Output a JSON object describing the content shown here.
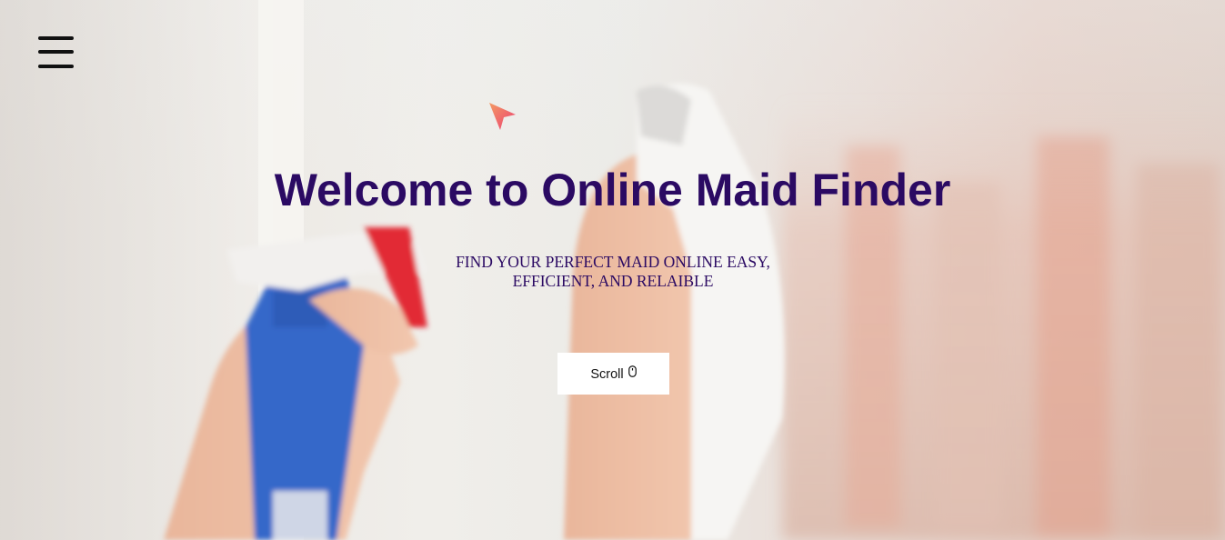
{
  "hero": {
    "title": "Welcome to Online Maid Finder",
    "subtitle_line1": "FIND YOUR PERFECT MAID ONLINE EASY,",
    "subtitle_line2": "EFFICIENT, AND RELAIBLE",
    "background_image": "hand-cleaning-window-with-spray-bottle-and-cloth"
  },
  "nav": {
    "menu_icon": "hamburger-menu-icon"
  },
  "cursor": {
    "icon": "arrow-pointer-icon",
    "color": "#f05a6e"
  },
  "scroll_button": {
    "label": "Scroll",
    "icon": "mouse-icon"
  },
  "colors": {
    "title": "#2b0a63",
    "subtitle": "#2b0a63",
    "button_bg": "#ffffff",
    "menu_icon": "#111111"
  }
}
